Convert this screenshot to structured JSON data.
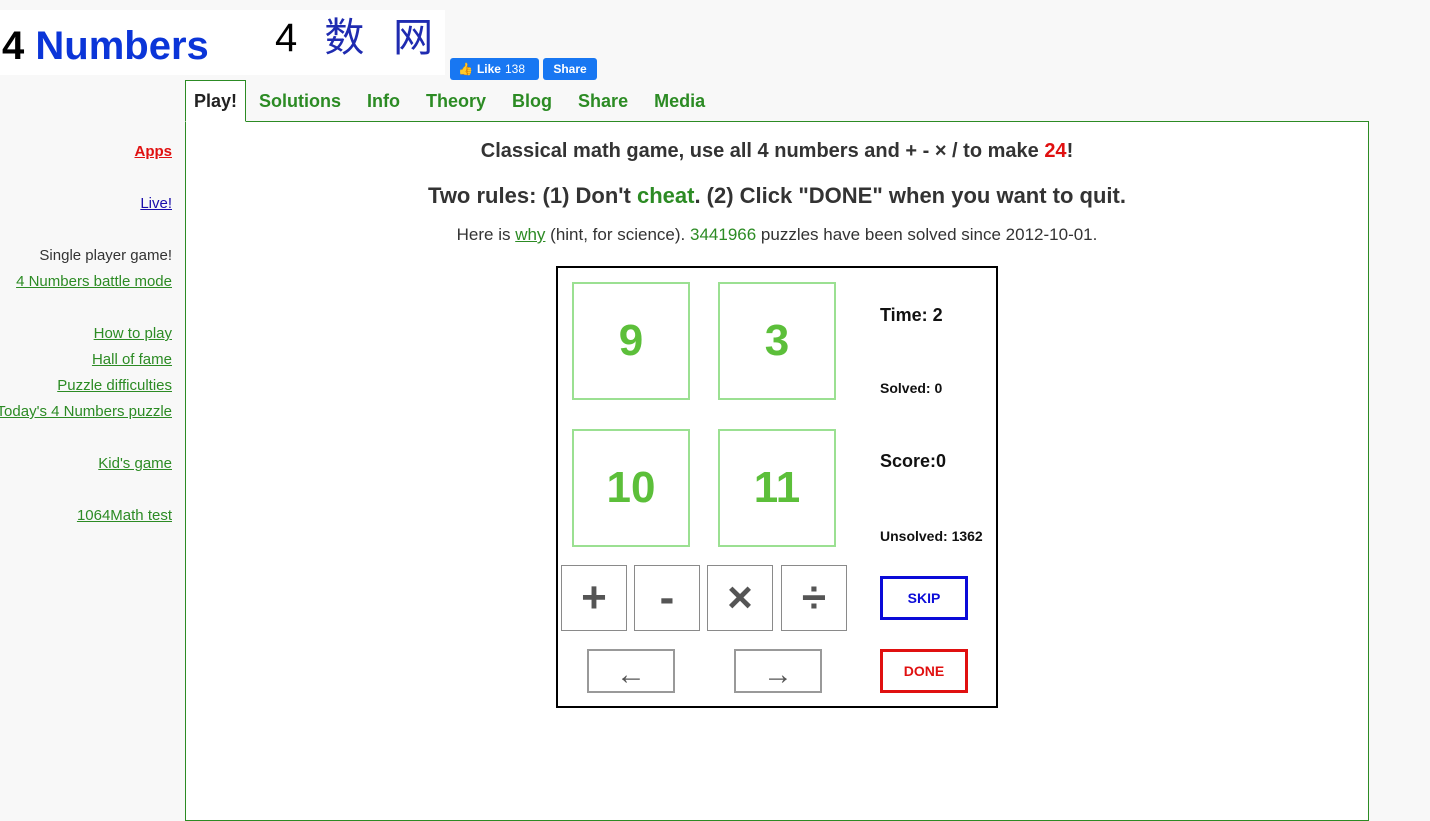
{
  "logo": {
    "en_four": "4",
    "en_word": "Numbers",
    "cn_four": "4",
    "cn_chars": "数 网"
  },
  "facebook": {
    "like_label": "Like",
    "like_count": "138",
    "share_label": "Share"
  },
  "tabs": [
    "Play!",
    "Solutions",
    "Info",
    "Theory",
    "Blog",
    "Share",
    "Media"
  ],
  "sidebar": {
    "apps": "Apps",
    "live": "Live!",
    "single_player": "Single player game!",
    "battle_mode": "4 Numbers battle mode",
    "how_to_play": "How to play",
    "hall_of_fame": "Hall of fame",
    "puzzle_difficulties": "Puzzle difficulties",
    "todays_puzzle": "Today's 4 Numbers puzzle",
    "kids_game": "Kid's game",
    "math_test": "1064Math test"
  },
  "headline": {
    "prefix": "Classical math game, use all 4 numbers and + - × / to make ",
    "target": "24",
    "suffix": "!"
  },
  "rules": {
    "prefix": "Two rules: (1) Don't ",
    "cheat": "cheat",
    "suffix": ". (2) Click \"DONE\" when you want to quit."
  },
  "hint": {
    "prefix": "Here is ",
    "why": "why",
    "middle": " (hint, for science). ",
    "solved_count": "3441966",
    "suffix": " puzzles have been solved since 2012-10-01."
  },
  "game": {
    "cards": [
      "9",
      "3",
      "10",
      "11"
    ],
    "operators": [
      "+",
      "-",
      "×",
      "÷"
    ],
    "back_arrow": "←",
    "forward_arrow": "→",
    "time": "Time: 2",
    "solved": "Solved:  0",
    "score": "Score:0",
    "unsolved": "Unsolved: 1362",
    "skip_label": "SKIP",
    "done_label": "DONE"
  }
}
